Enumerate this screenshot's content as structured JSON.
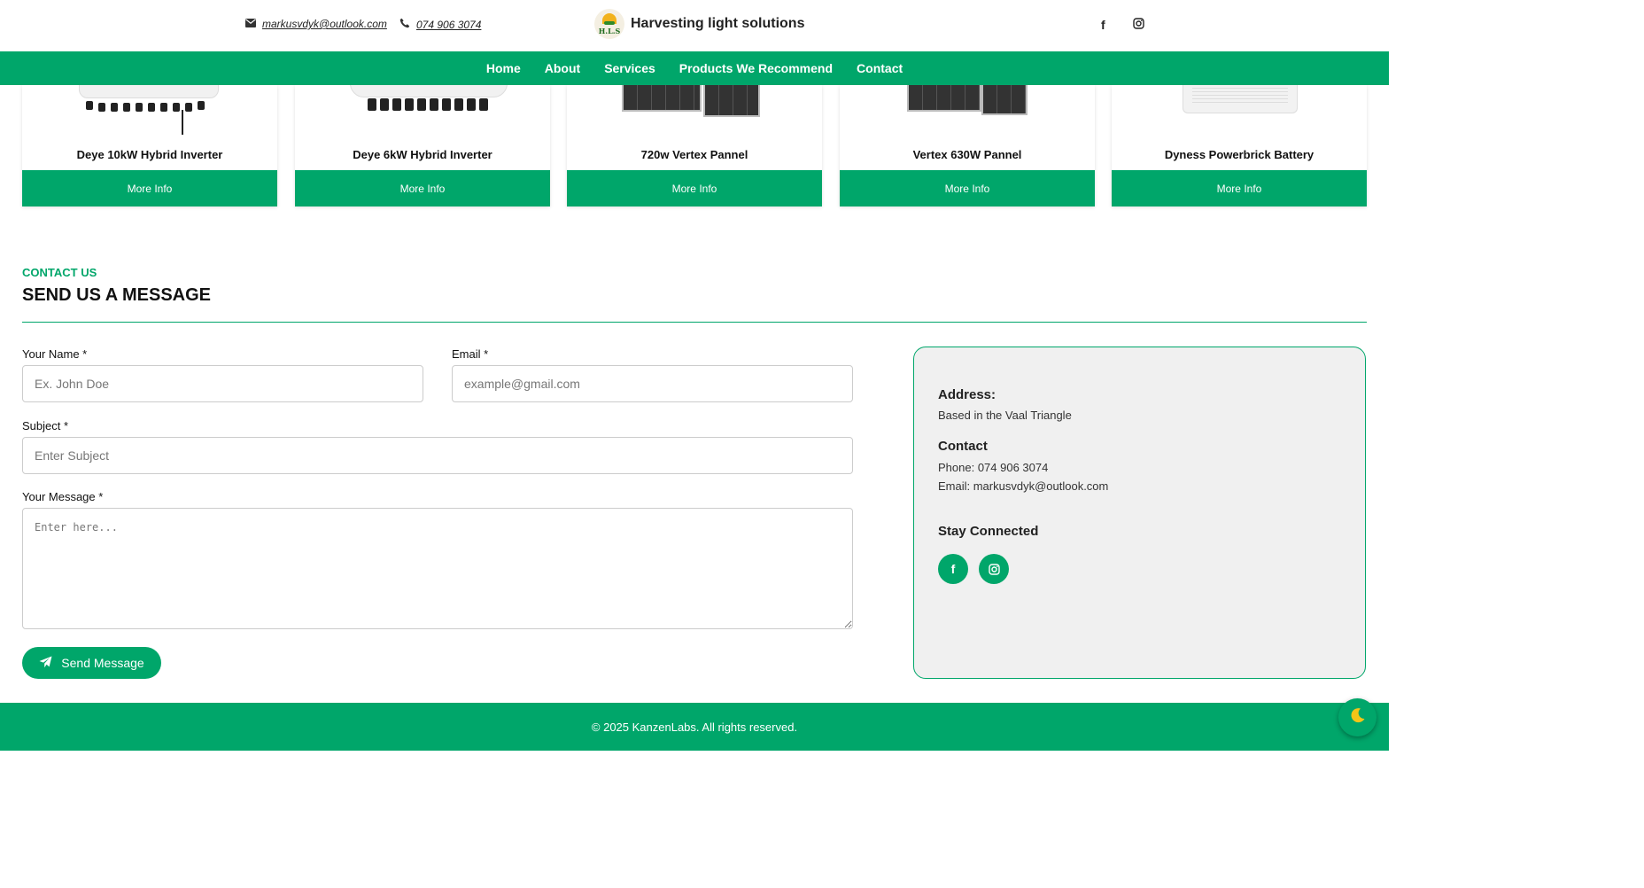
{
  "header": {
    "email": "markusvdyk@outlook.com",
    "phone": "074 906 3074",
    "logo_text": "H.L.S",
    "brand_name": "Harvesting light solutions",
    "social": {
      "facebook": "f",
      "instagram": "◎"
    }
  },
  "nav": {
    "items": [
      "Home",
      "About",
      "Services",
      "Products We Recommend",
      "Contact"
    ]
  },
  "products": {
    "more_label": "More Info",
    "items": [
      {
        "title": "Deye 10kW Hybrid Inverter"
      },
      {
        "title": "Deye 6kW Hybrid Inverter"
      },
      {
        "title": "720w Vertex Pannel"
      },
      {
        "title": "Vertex 630W Pannel"
      },
      {
        "title": "Dyness Powerbrick Battery"
      }
    ]
  },
  "contact": {
    "eyebrow": "CONTACT US",
    "heading": "SEND US A MESSAGE",
    "form": {
      "name_label": "Your Name *",
      "name_placeholder": "Ex. John Doe",
      "email_label": "Email *",
      "email_placeholder": "example@gmail.com",
      "subject_label": "Subject *",
      "subject_placeholder": "Enter Subject",
      "message_label": "Your Message *",
      "message_placeholder": "Enter here...",
      "send_label": "Send Message"
    },
    "info": {
      "address_heading": "Address:",
      "address_text": "Based in the Vaal Triangle",
      "contact_heading": "Contact",
      "phone_line": "Phone: 074 906 3074",
      "email_line": "Email: markusvdyk@outlook.com",
      "stay_heading": "Stay Connected"
    }
  },
  "footer": {
    "copyright": "© 2025 KanzenLabs. All rights reserved."
  },
  "colors": {
    "accent": "#00a66a",
    "info_bg": "#f0f0f0",
    "toggle_icon": "#f5c518"
  },
  "icons": {
    "mail": "envelope-icon",
    "phone": "phone-icon",
    "facebook": "facebook-icon",
    "instagram": "instagram-icon",
    "send": "paper-plane-icon",
    "theme": "moon-icon"
  }
}
